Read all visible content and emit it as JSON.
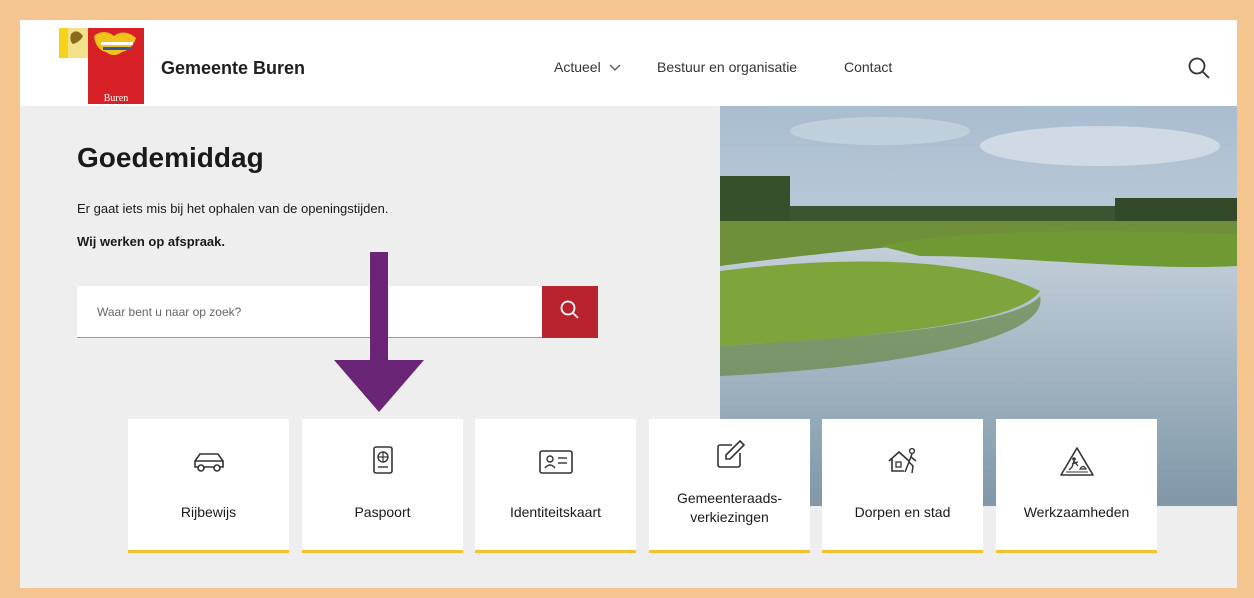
{
  "header": {
    "site_name": "Gemeente Buren",
    "logo_text": "Buren",
    "nav": [
      {
        "label": "Actueel"
      },
      {
        "label": "Bestuur en organisatie"
      },
      {
        "label": "Contact"
      }
    ]
  },
  "hero": {
    "greeting": "Goedemiddag",
    "hours_message": "Er gaat iets mis bij het ophalen van de openingstijden.",
    "appointment_message": "Wij werken op afspraak.",
    "search_placeholder": "Waar bent u naar op zoek?"
  },
  "tiles": [
    {
      "label": "Rijbewijs",
      "icon": "car-icon"
    },
    {
      "label": "Paspoort",
      "icon": "passport-icon"
    },
    {
      "label": "Identiteitskaart",
      "icon": "id-card-icon"
    },
    {
      "label_line1": "Gemeenteraads-",
      "label_line2": "verkiezingen",
      "icon": "edit-icon"
    },
    {
      "label": "Dorpen en stad",
      "icon": "house-walker-icon"
    },
    {
      "label": "Werkzaamheden",
      "icon": "roadwork-sign-icon"
    }
  ],
  "colors": {
    "accent_red": "#b8232f",
    "tile_underline": "#f2c230",
    "annotation_arrow": "#6b2577",
    "frame_border": "#f4c58e"
  }
}
